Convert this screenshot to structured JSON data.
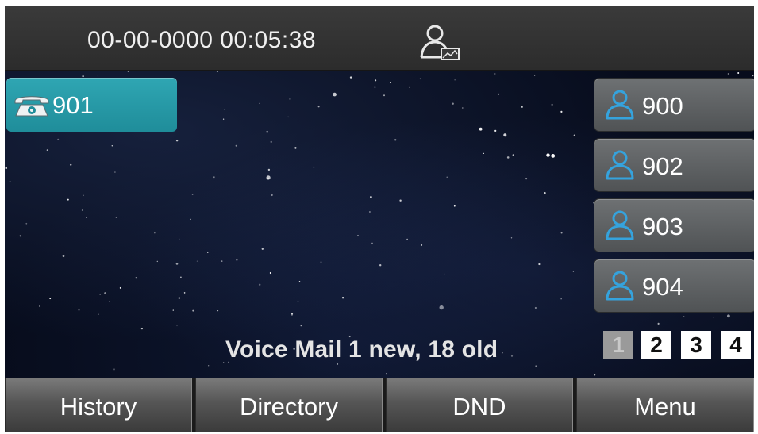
{
  "status_bar": {
    "datetime": "00-00-0000 00:05:38",
    "status_icon": "user-status-icon"
  },
  "line_key": {
    "label": "901",
    "icon": "phone-icon",
    "color": "#2aa0ae"
  },
  "blf_keys": [
    {
      "label": "900",
      "icon": "user-icon"
    },
    {
      "label": "902",
      "icon": "user-icon"
    },
    {
      "label": "903",
      "icon": "user-icon"
    },
    {
      "label": "904",
      "icon": "user-icon"
    }
  ],
  "voicemail": {
    "text": "Voice Mail 1 new, 18 old"
  },
  "pages": {
    "items": [
      "1",
      "2",
      "3",
      "4"
    ],
    "current": "1"
  },
  "softkeys": [
    {
      "label": "History"
    },
    {
      "label": "Directory"
    },
    {
      "label": "DND"
    },
    {
      "label": "Menu"
    }
  ],
  "colors": {
    "accent": "#2aa0ae",
    "icon_blue": "#35a3dd",
    "background": "#070c1c"
  }
}
